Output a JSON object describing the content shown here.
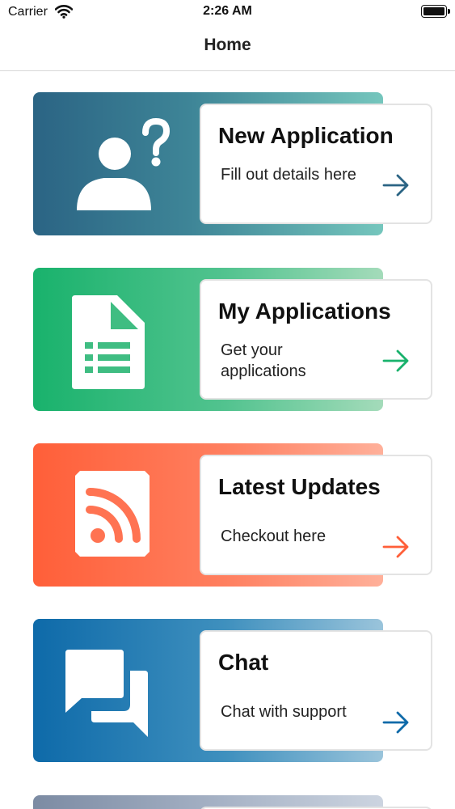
{
  "status_bar": {
    "carrier": "Carrier",
    "time": "2:26 AM"
  },
  "nav": {
    "title": "Home"
  },
  "colors": {
    "new_application": "#2b6484",
    "my_applications": "#19b26c",
    "latest_updates": "#ff5f39",
    "chat": "#0e6aa9"
  },
  "cards": [
    {
      "title": "New Application",
      "description": "Fill out details here",
      "icon": "user-question-icon"
    },
    {
      "title": "My Applications",
      "description": "Get your applications",
      "icon": "spreadsheet-document-icon"
    },
    {
      "title": "Latest Updates",
      "description": "Checkout here",
      "icon": "rss-feed-icon"
    },
    {
      "title": "Chat",
      "description": "Chat with support",
      "icon": "chat-bubbles-icon"
    }
  ]
}
